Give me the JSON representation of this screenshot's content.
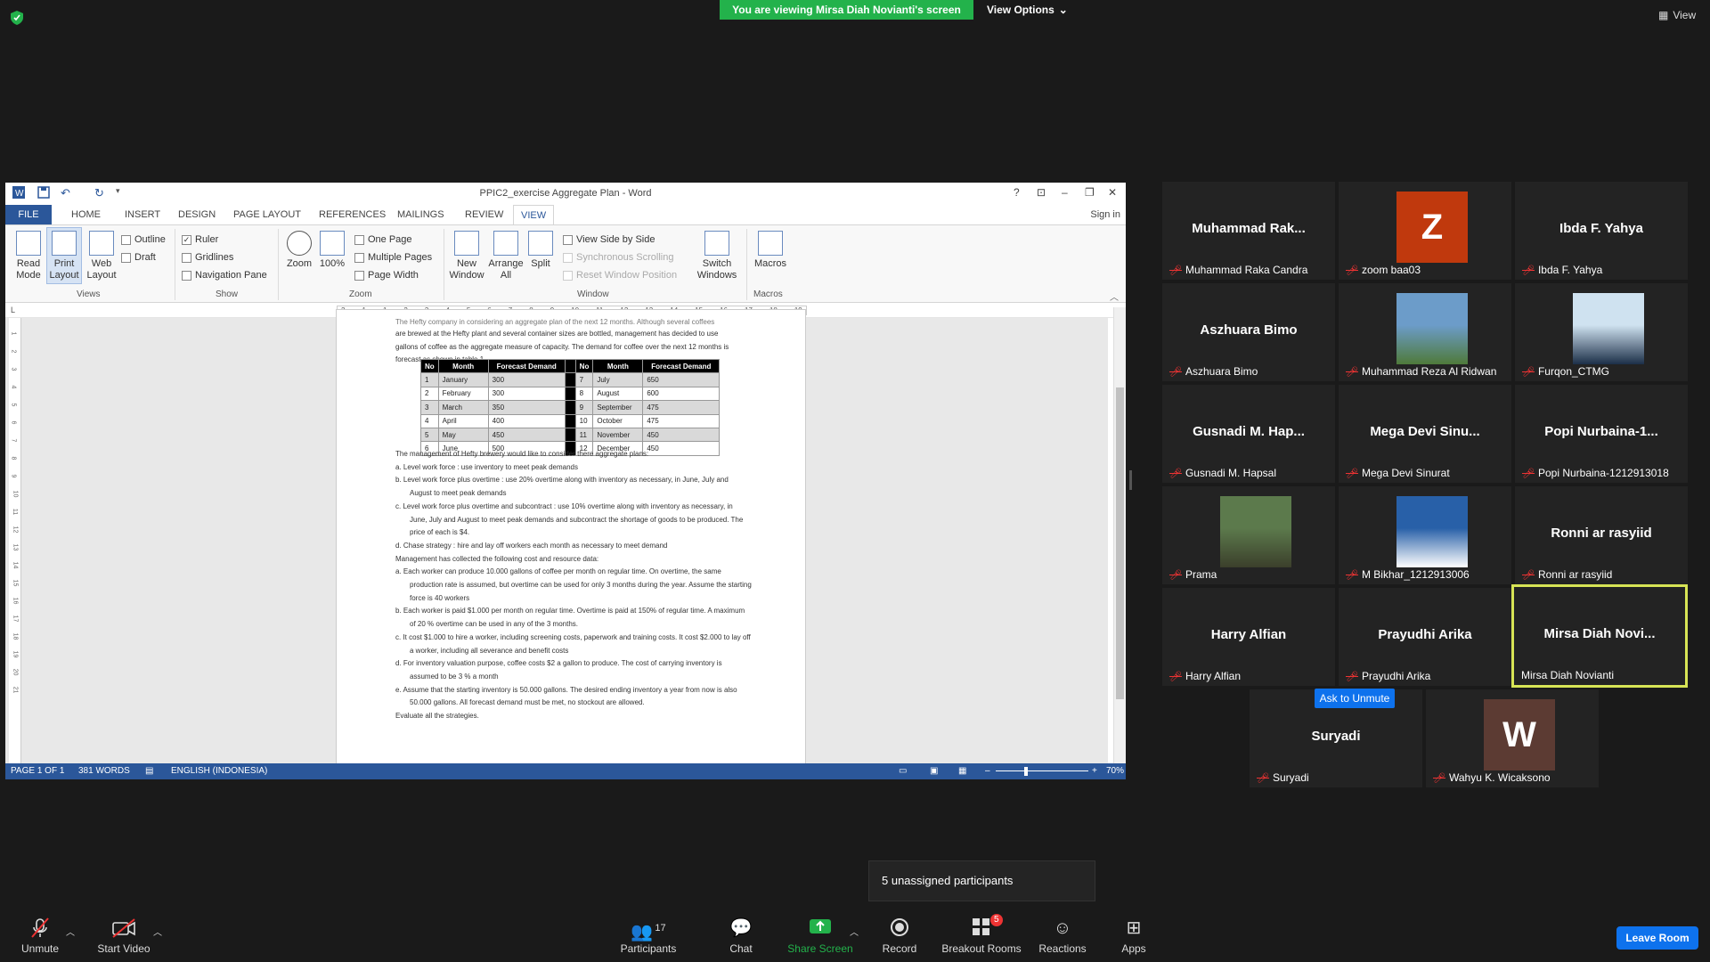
{
  "zoom": {
    "banner": "You are viewing Mirsa Diah Novianti's screen",
    "view_options": "View Options",
    "view_top": "View"
  },
  "word": {
    "title": "PPIC2_exercise Aggregate Plan - Word",
    "tabs": [
      "FILE",
      "HOME",
      "INSERT",
      "DESIGN",
      "PAGE LAYOUT",
      "REFERENCES",
      "MAILINGS",
      "REVIEW",
      "VIEW"
    ],
    "sign_in": "Sign in",
    "ribbon": {
      "views": {
        "label": "Views",
        "read_mode": "Read Mode",
        "print_layout": "Print Layout",
        "web_layout": "Web Layout",
        "outline": "Outline",
        "draft": "Draft"
      },
      "show": {
        "label": "Show",
        "ruler": "Ruler",
        "gridlines": "Gridlines",
        "navigation_pane": "Navigation Pane"
      },
      "zoom": {
        "label": "Zoom",
        "zoom": "Zoom",
        "hundred": "100%",
        "one_page": "One Page",
        "multiple_pages": "Multiple Pages",
        "page_width": "Page Width"
      },
      "window": {
        "label": "Window",
        "new_window": "New Window",
        "arrange_all": "Arrange All",
        "split": "Split",
        "side_by_side": "View Side by Side",
        "sync_scroll": "Synchronous Scrolling",
        "reset_pos": "Reset Window Position",
        "switch": "Switch Windows"
      },
      "macros": {
        "label": "Macros",
        "macros": "Macros"
      }
    },
    "ruler_ticks": [
      "2",
      "1",
      "1",
      "2",
      "3",
      "4",
      "5",
      "6",
      "7",
      "8",
      "9",
      "10",
      "11",
      "12",
      "13",
      "14",
      "15",
      "16",
      "17",
      "18",
      "19"
    ],
    "doc": {
      "intro_cut": "The Hefty company in considering an aggregate plan of the next 12 months. Although several coffees",
      "intro": "are brewed at the Hefty plant and several container sizes are bottled, management has decided to use gallons of coffee as the aggregate measure of capacity. The demand for coffee over the next 12 months is forecast as shown in table 1.",
      "table_headers": [
        "No",
        "Month",
        "Forecast Demand",
        "No",
        "Month",
        "Forecast Demand"
      ],
      "table_rows": [
        [
          "1",
          "January",
          "300",
          "7",
          "July",
          "650"
        ],
        [
          "2",
          "February",
          "300",
          "8",
          "August",
          "600"
        ],
        [
          "3",
          "March",
          "350",
          "9",
          "September",
          "475"
        ],
        [
          "4",
          "April",
          "400",
          "10",
          "October",
          "475"
        ],
        [
          "5",
          "May",
          "450",
          "11",
          "November",
          "450"
        ],
        [
          "6",
          "June",
          "500",
          "12",
          "December",
          "450"
        ]
      ],
      "plans_intro": "The management of Hefty brewery would like to consider there aggregate plans:",
      "plans": [
        "a.   Level work force : use inventory to meet peak demands",
        "b.   Level work force plus overtime : use 20% overtime along with inventory as necessary, in June, July and August to meet peak demands",
        "c.   Level work force plus overtime and subcontract : use 10% overtime along with inventory as necessary, in June, July and August to meet peak demands and subcontract the shortage of goods to be produced. The price of each is $4.",
        "d.   Chase strategy : hire and lay off workers each month as necessary to meet demand"
      ],
      "mgmt_intro": "Management has collected the following cost and resource data:",
      "data": [
        "a.   Each worker can produce 10.000 gallons of coffee per month on regular time. On overtime, the same production rate is assumed, but overtime can be used for only 3 months during the year. Assume the starting force is 40 workers",
        "b.   Each worker is paid $1.000 per month on regular time. Overtime is paid at 150% of regular time. A maximum of 20 % overtime can be used in any of the 3 months.",
        "c.   It cost $1.000 to hire a worker, including screening costs, paperwork and training costs. It cost $2.000 to lay off a worker, including all severance and benefit costs",
        "d.   For inventory valuation purpose, coffee costs $2 a gallon to produce. The cost of carrying inventory is assumed to be 3 % a month",
        "e.   Assume that the starting inventory is 50.000 gallons. The desired ending inventory a year from now is also 50.000 gallons. All forecast demand must be met, no stockout are allowed."
      ],
      "closing": "Evaluate all the strategies."
    },
    "status": {
      "page": "PAGE 1 OF 1",
      "words": "381 WORDS",
      "lang": "ENGLISH (INDONESIA)",
      "zoom": "70%"
    }
  },
  "participants": [
    {
      "big": "Muhammad  Rak...",
      "small": "Muhammad Raka Candra"
    },
    {
      "big": "",
      "small": "zoom baa03",
      "avatar_letter": "Z",
      "avatar_color": "#c0390d"
    },
    {
      "big": "Ibda F. Yahya",
      "small": "Ibda F. Yahya"
    },
    {
      "big": "Aszhuara Bimo",
      "small": "Aszhuara Bimo"
    },
    {
      "big": "",
      "small": "Muhammad Reza Al Ridwan"
    },
    {
      "big": "",
      "small": "Furqon_CTMG"
    },
    {
      "big": "Gusnadi  M. Hap...",
      "small": "Gusnadi M. Hapsal"
    },
    {
      "big": "Mega  Devi  Sinu...",
      "small": "Mega Devi Sinurat"
    },
    {
      "big": "Popi  Nurbaina-1...",
      "small": "Popi Nurbaina-1212913018"
    },
    {
      "big": "",
      "small": "Prama"
    },
    {
      "big": "",
      "small": "M Bikhar_1212913006"
    },
    {
      "big": "Ronni ar rasyiid",
      "small": "Ronni ar rasyiid"
    },
    {
      "big": "Harry Alfian",
      "small": "Harry Alfian"
    },
    {
      "big": "Prayudhi Arika",
      "small": "Prayudhi Arika"
    },
    {
      "big": "Mirsa  Diah  Novi...",
      "small": "Mirsa Diah Novianti"
    },
    {
      "big": "Suryadi",
      "small": "Suryadi"
    },
    {
      "big": "",
      "small": "Wahyu K. Wicaksono",
      "avatar_letter": "W",
      "avatar_color": "#5c3b33"
    }
  ],
  "ask_unmute": "Ask to Unmute",
  "unassigned": "5 unassigned participants",
  "toolbar": {
    "unmute": "Unmute",
    "start_video": "Start Video",
    "participants": "Participants",
    "participants_count": "17",
    "chat": "Chat",
    "share_screen": "Share Screen",
    "record": "Record",
    "breakout": "Breakout Rooms",
    "breakout_badge": "5",
    "reactions": "Reactions",
    "apps": "Apps",
    "leave": "Leave Room"
  },
  "colors": {
    "zoom_green": "#23b24b",
    "zoom_blue": "#0e72ed",
    "word_blue": "#2b579a",
    "active_speaker": "#d7e455",
    "muted_red": "#e33333"
  }
}
